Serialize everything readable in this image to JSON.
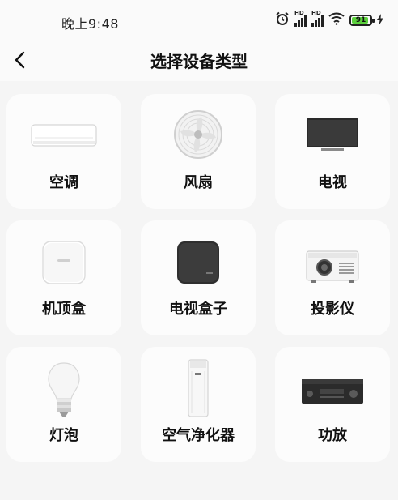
{
  "status_bar": {
    "time": "晚上9:48",
    "signal_label_1": "HD",
    "signal_label_2": "HD",
    "battery_level": "91",
    "icons": [
      "alarm-icon",
      "signal-icon",
      "signal-icon",
      "wifi-icon",
      "battery-icon",
      "charging-icon"
    ]
  },
  "header": {
    "title": "选择设备类型",
    "back_icon": "chevron-left-icon"
  },
  "devices": [
    {
      "label": "空调",
      "icon": "air-conditioner-icon"
    },
    {
      "label": "风扇",
      "icon": "fan-icon"
    },
    {
      "label": "电视",
      "icon": "tv-icon"
    },
    {
      "label": "机顶盒",
      "icon": "set-top-box-icon"
    },
    {
      "label": "电视盒子",
      "icon": "tv-box-icon"
    },
    {
      "label": "投影仪",
      "icon": "projector-icon"
    },
    {
      "label": "灯泡",
      "icon": "light-bulb-icon"
    },
    {
      "label": "空气净化器",
      "icon": "air-purifier-icon"
    },
    {
      "label": "功放",
      "icon": "amplifier-icon"
    }
  ],
  "colors": {
    "background": "#f5f5f5",
    "card": "#fcfcfc",
    "battery_green": "#5bd03c"
  }
}
